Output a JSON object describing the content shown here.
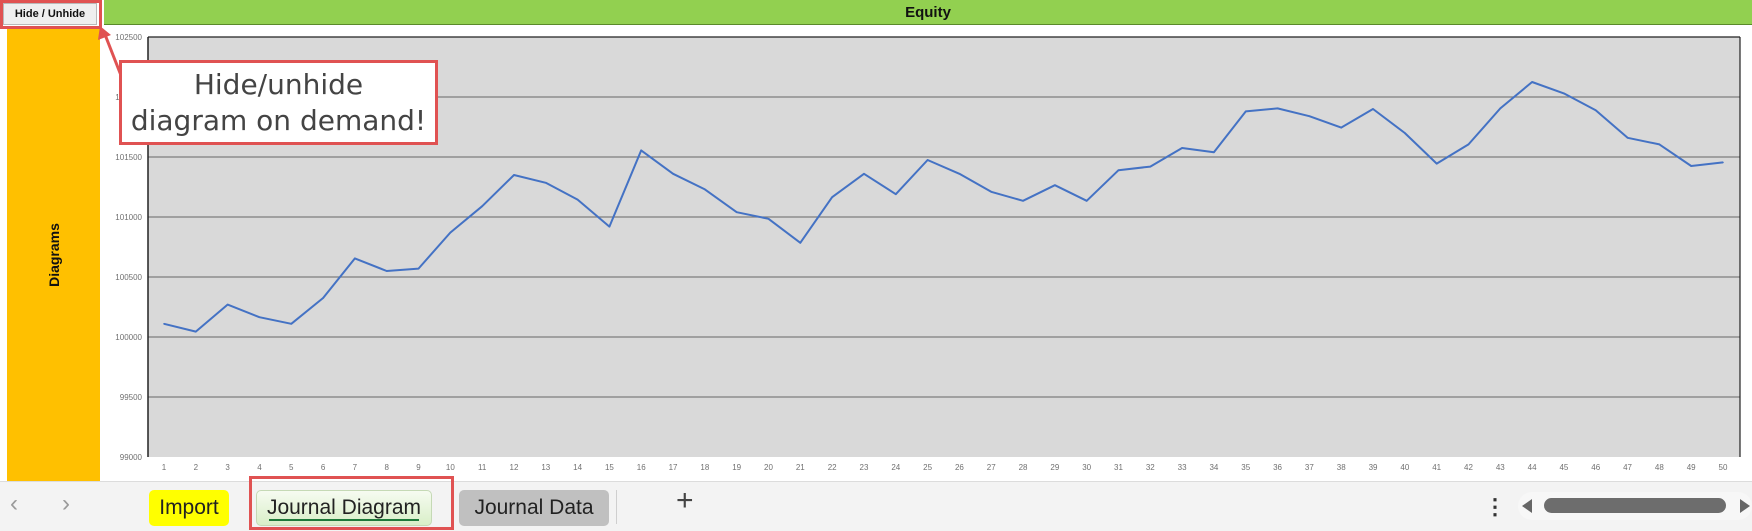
{
  "toolbar": {
    "hide_unhide_label": "Hide / Unhide"
  },
  "header": {
    "title": "Equity"
  },
  "sidebar": {
    "label": "Diagrams"
  },
  "callout": {
    "line1": "Hide/unhide",
    "line2": "diagram on demand!"
  },
  "colors": {
    "header_bg": "#92d050",
    "sidebar_bg": "#ffc000",
    "plot_bg": "#d9d9d9",
    "series_line": "#4472c4",
    "highlight": "#e05252",
    "tab_import_bg": "#ffff00",
    "tab_data_bg": "#c0c0c0"
  },
  "tabs": [
    {
      "label": "Import",
      "active": false
    },
    {
      "label": "Journal Diagram",
      "active": true
    },
    {
      "label": "Journal Data",
      "active": false
    }
  ],
  "tabbar": {
    "prev_icon": "chevron-left",
    "next_icon": "chevron-right",
    "add_icon": "+",
    "more_icon": "⋮"
  },
  "chart_data": {
    "type": "line",
    "title": "Equity",
    "xlabel": "",
    "ylabel": "",
    "ylim": [
      99000,
      102500
    ],
    "yticks": [
      99000,
      99500,
      100000,
      100500,
      101000,
      101500,
      102000,
      102500
    ],
    "ytick_labels": [
      "99000",
      "99500",
      "100000",
      "100500",
      "101000",
      "101500",
      "102000",
      "102500"
    ],
    "grid": true,
    "legend": "none",
    "x": [
      1,
      2,
      3,
      4,
      5,
      6,
      7,
      8,
      9,
      10,
      11,
      12,
      13,
      14,
      15,
      16,
      17,
      18,
      19,
      20,
      21,
      22,
      23,
      24,
      25,
      26,
      27,
      28,
      29,
      30,
      31,
      32,
      33,
      34,
      35,
      36,
      37,
      38,
      39,
      40,
      41,
      42,
      43,
      44,
      45,
      46,
      47,
      48,
      49,
      50
    ],
    "series": [
      {
        "name": "Equity",
        "values": [
          100110,
          100045,
          100270,
          100165,
          100110,
          100325,
          100655,
          100550,
          100570,
          100870,
          101090,
          101350,
          101285,
          101145,
          100920,
          101555,
          101360,
          101230,
          101040,
          100985,
          100785,
          101165,
          101360,
          101190,
          101475,
          101360,
          101210,
          101135,
          101265,
          101135,
          101390,
          101420,
          101575,
          101540,
          101880,
          101905,
          101840,
          101745,
          101900,
          101700,
          101445,
          101605,
          101905,
          102125,
          102030,
          101890,
          101660,
          101605,
          101425,
          101455
        ]
      }
    ]
  }
}
